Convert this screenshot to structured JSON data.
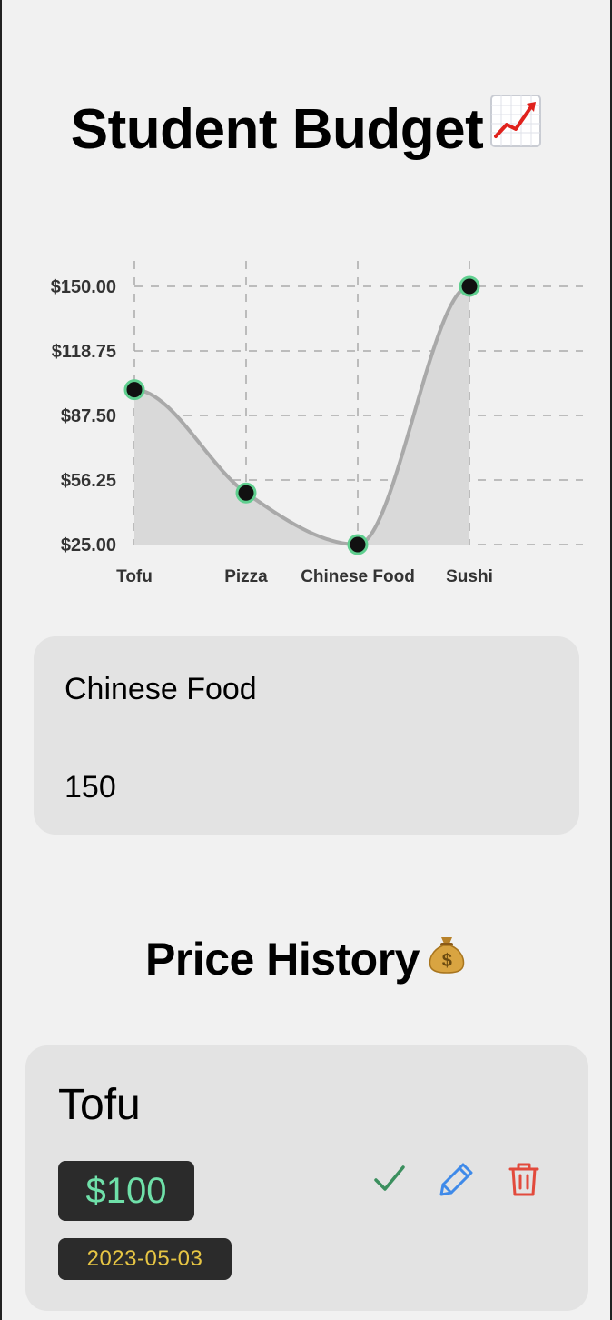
{
  "header": {
    "title": "Student Budget",
    "title_icon": "chart-increasing-icon"
  },
  "chart_data": {
    "type": "area",
    "categories": [
      "Tofu",
      "Pizza",
      "Chinese Food",
      "Sushi"
    ],
    "values": [
      100,
      50,
      25,
      150
    ],
    "y_ticks": [
      "$25.00",
      "$56.25",
      "$87.50",
      "$118.75",
      "$150.00"
    ],
    "ylim": [
      25,
      150
    ],
    "grid": true,
    "line_color": "#a9a9a9",
    "fill_color": "#d9d9d9",
    "point_fill": "#111111",
    "point_stroke": "#5fcf8f"
  },
  "form": {
    "name_value": "Chinese Food",
    "price_value": "150"
  },
  "history": {
    "title": "Price History",
    "title_icon": "money-bag-icon",
    "items": [
      {
        "name": "Tofu",
        "price": "$100",
        "date": "2023-05-03"
      }
    ]
  },
  "colors": {
    "check": "#3b8f5e",
    "pencil": "#3f8ae9",
    "trash": "#e24a3c",
    "price_text": "#6fe0a9",
    "date_text": "#e6c544"
  }
}
